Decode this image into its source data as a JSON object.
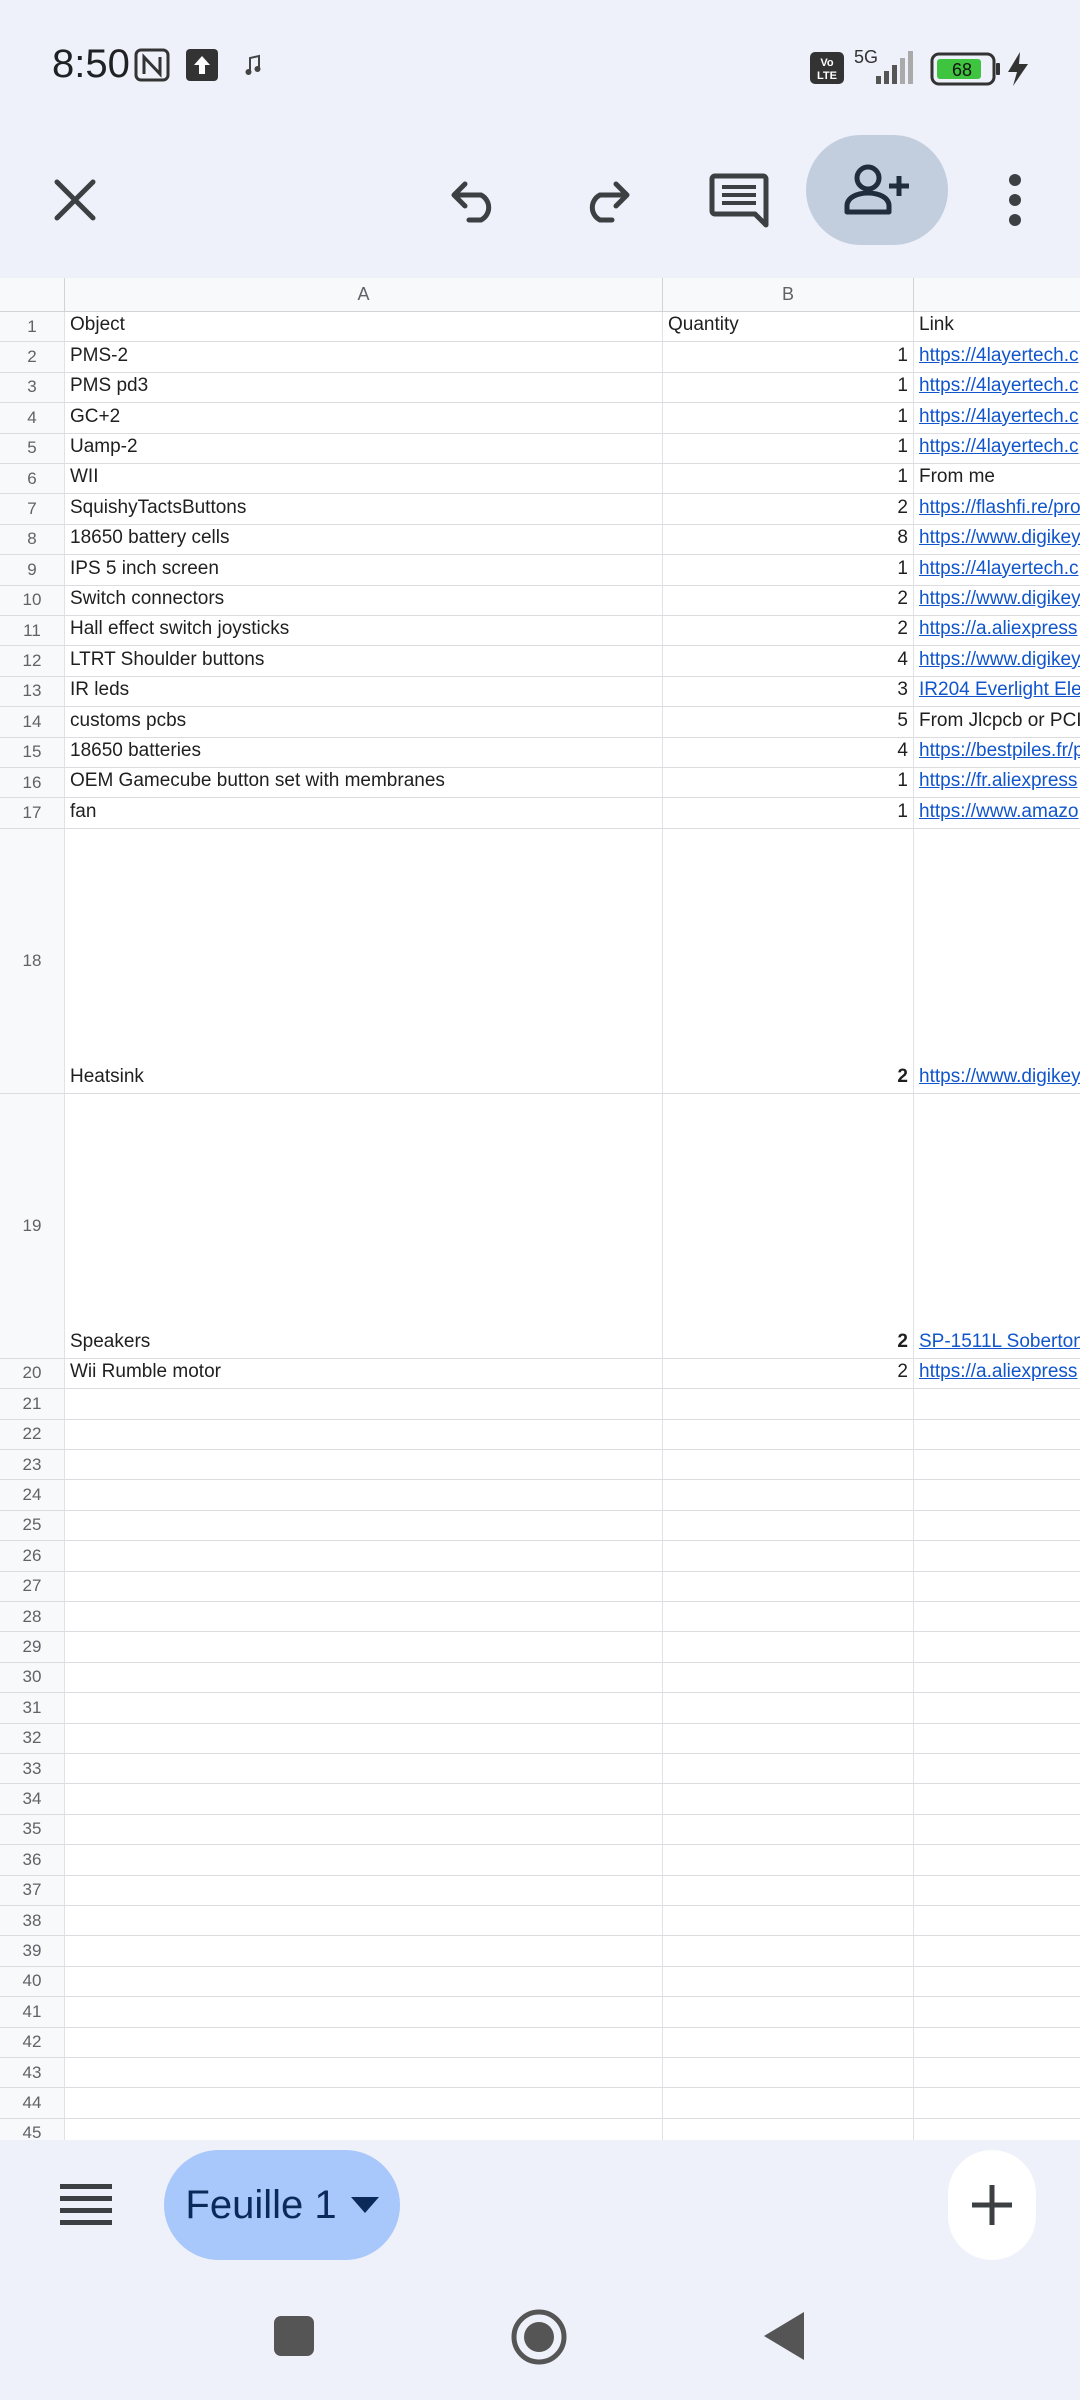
{
  "status": {
    "time": "8:50",
    "network": "5G",
    "volte": "Vo\nLTE",
    "battery": "68"
  },
  "toolbar": {
    "icons": [
      "close-icon",
      "undo-icon",
      "redo-icon",
      "comment-icon",
      "add-person-icon",
      "more-vert-icon"
    ]
  },
  "sheet": {
    "columns": [
      "A",
      "B"
    ],
    "rows": [
      {
        "n": "1",
        "a": "Object",
        "b": "Quantity",
        "c": "Link",
        "b_align": "left"
      },
      {
        "n": "2",
        "a": "PMS-2",
        "b": "1",
        "c": "https://4layertech.c",
        "link": true
      },
      {
        "n": "3",
        "a": "PMS pd3",
        "b": "1",
        "c": "https://4layertech.c",
        "link": true
      },
      {
        "n": "4",
        "a": "GC+2",
        "b": "1",
        "c": "https://4layertech.c",
        "link": true
      },
      {
        "n": "5",
        "a": "Uamp-2",
        "b": "1",
        "c": "https://4layertech.c",
        "link": true
      },
      {
        "n": "6",
        "a": "WII",
        "b": "1",
        "c": "From me"
      },
      {
        "n": "7",
        "a": "SquishyTactsButtons",
        "b": "2",
        "c": "https://flashfi.re/pro",
        "link": true
      },
      {
        "n": "8",
        "a": "18650 battery cells",
        "b": "8",
        "c": "https://www.digikey",
        "link": true
      },
      {
        "n": "9",
        "a": "IPS 5 inch screen",
        "b": "1",
        "c": "https://4layertech.c",
        "link": true
      },
      {
        "n": "10",
        "a": "Switch connectors",
        "b": "2",
        "c": "https://www.digikey",
        "link": true
      },
      {
        "n": "11",
        "a": "Hall effect switch joysticks",
        "b": "2",
        "c": "https://a.aliexpress",
        "link": true
      },
      {
        "n": "12",
        "a": "LTRT Shoulder buttons",
        "b": "4",
        "c": "https://www.digikey",
        "link": true
      },
      {
        "n": "13",
        "a": "IR leds",
        "b": "3",
        "c": "IR204 Everlight Ele",
        "link": true
      },
      {
        "n": "14",
        "a": "customs pcbs",
        "b": "5",
        "c": "From Jlcpcb or PCI"
      },
      {
        "n": "15",
        "a": "18650 batteries",
        "b": "4",
        "c": "https://bestpiles.fr/p",
        "link": true
      },
      {
        "n": "16",
        "a": "OEM Gamecube button set with membranes",
        "b": "1",
        "c": "https://fr.aliexpress",
        "link": true
      },
      {
        "n": "17",
        "a": "fan",
        "b": "1",
        "c": "https://www.amazo",
        "link": true
      },
      {
        "n": "18",
        "a": "Heatsink",
        "b": "2",
        "c": "https://www.digikey",
        "link": true,
        "tall": true,
        "bold_b": true
      },
      {
        "n": "19",
        "a": "Speakers",
        "b": "2",
        "c": "SP-1511L Soberton",
        "link": true,
        "tall": true,
        "bold_b": true
      },
      {
        "n": "20",
        "a": "Wii Rumble motor",
        "b": "2",
        "c": "https://a.aliexpress",
        "link": true
      },
      {
        "n": "21"
      },
      {
        "n": "22"
      },
      {
        "n": "23"
      },
      {
        "n": "24"
      },
      {
        "n": "25"
      },
      {
        "n": "26"
      },
      {
        "n": "27"
      },
      {
        "n": "28"
      },
      {
        "n": "29"
      },
      {
        "n": "30"
      },
      {
        "n": "31"
      },
      {
        "n": "32"
      },
      {
        "n": "33"
      },
      {
        "n": "34"
      },
      {
        "n": "35"
      },
      {
        "n": "36"
      },
      {
        "n": "37"
      },
      {
        "n": "38"
      },
      {
        "n": "39"
      },
      {
        "n": "40"
      },
      {
        "n": "41"
      },
      {
        "n": "42"
      },
      {
        "n": "43"
      },
      {
        "n": "44"
      },
      {
        "n": "45"
      }
    ]
  },
  "bottom": {
    "sheet_tab_label": "Feuille 1"
  },
  "colors": {
    "accent": "#a8c7fa",
    "link": "#1155cc",
    "share_bg": "#c2cedd"
  }
}
